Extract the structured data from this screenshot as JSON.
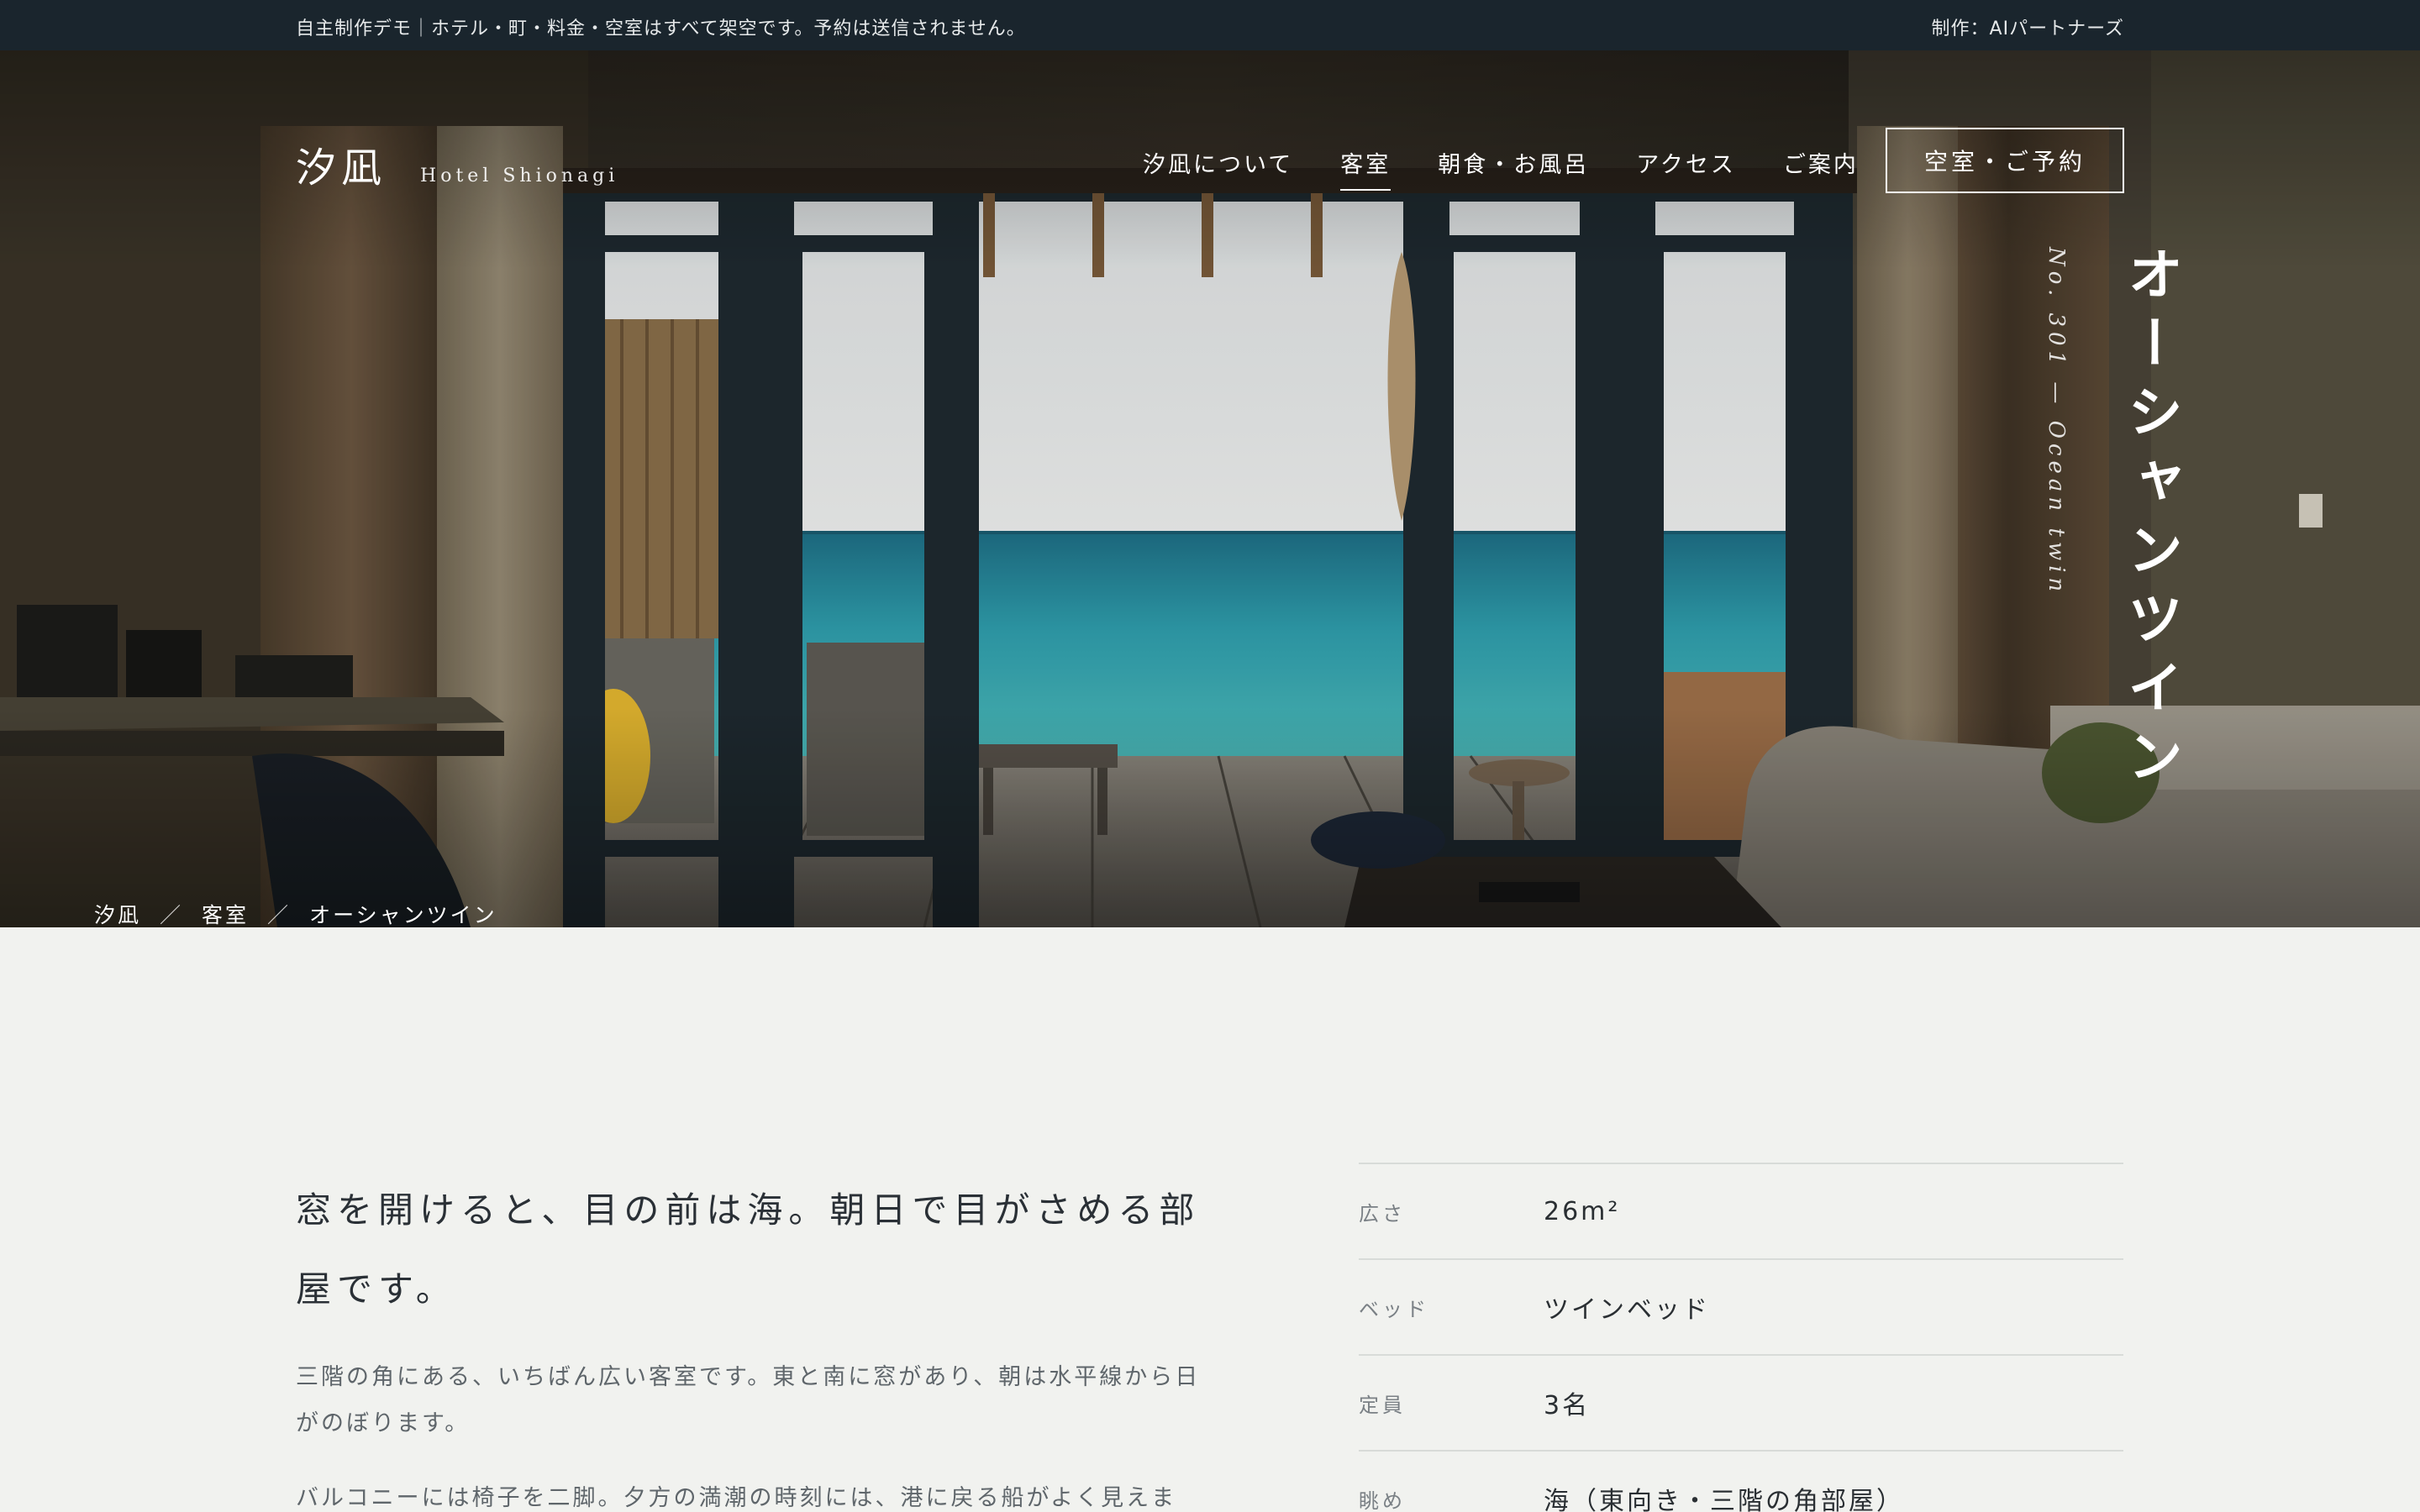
{
  "notice": {
    "left": "自主制作デモ｜ホテル・町・料金・空室はすべて架空です。予約は送信されません。",
    "right": "制作：AIパートナーズ"
  },
  "brand": {
    "mark": "汐凪",
    "sub": "Hotel Shionagi"
  },
  "nav": {
    "items": [
      {
        "label": "汐凪について"
      },
      {
        "label": "客室"
      },
      {
        "label": "朝食・お風呂"
      },
      {
        "label": "アクセス"
      },
      {
        "label": "ご案内"
      }
    ],
    "active_index": 1,
    "reserve_label": "空室・ご予約"
  },
  "hero": {
    "title": "オーシャンツイン",
    "room_no": "No. 301 — Ocean twin",
    "breadcrumb": [
      "汐凪",
      "客室",
      "オーシャンツイン"
    ],
    "breadcrumb_sep": "／"
  },
  "main": {
    "lead": "窓を開けると、目の前は海。朝日で目がさめる部屋です。",
    "paragraphs": [
      "三階の角にある、いちばん広い客室です。東と南に窓があり、朝は水平線から日がのぼります。",
      "バルコニーには椅子を二脚。夕方の満潮の時刻には、港に戻る船がよく見えま"
    ]
  },
  "spec": [
    {
      "label": "広さ",
      "value": "26m²"
    },
    {
      "label": "ベッド",
      "value": "ツインベッド"
    },
    {
      "label": "定員",
      "value": "3名"
    },
    {
      "label": "眺め",
      "value": "海（東向き・三階の角部屋）"
    }
  ],
  "colors": {
    "notice_bg": "#1a252d",
    "page_bg": "#f1f2ef",
    "sea": "#3fb4b8"
  }
}
